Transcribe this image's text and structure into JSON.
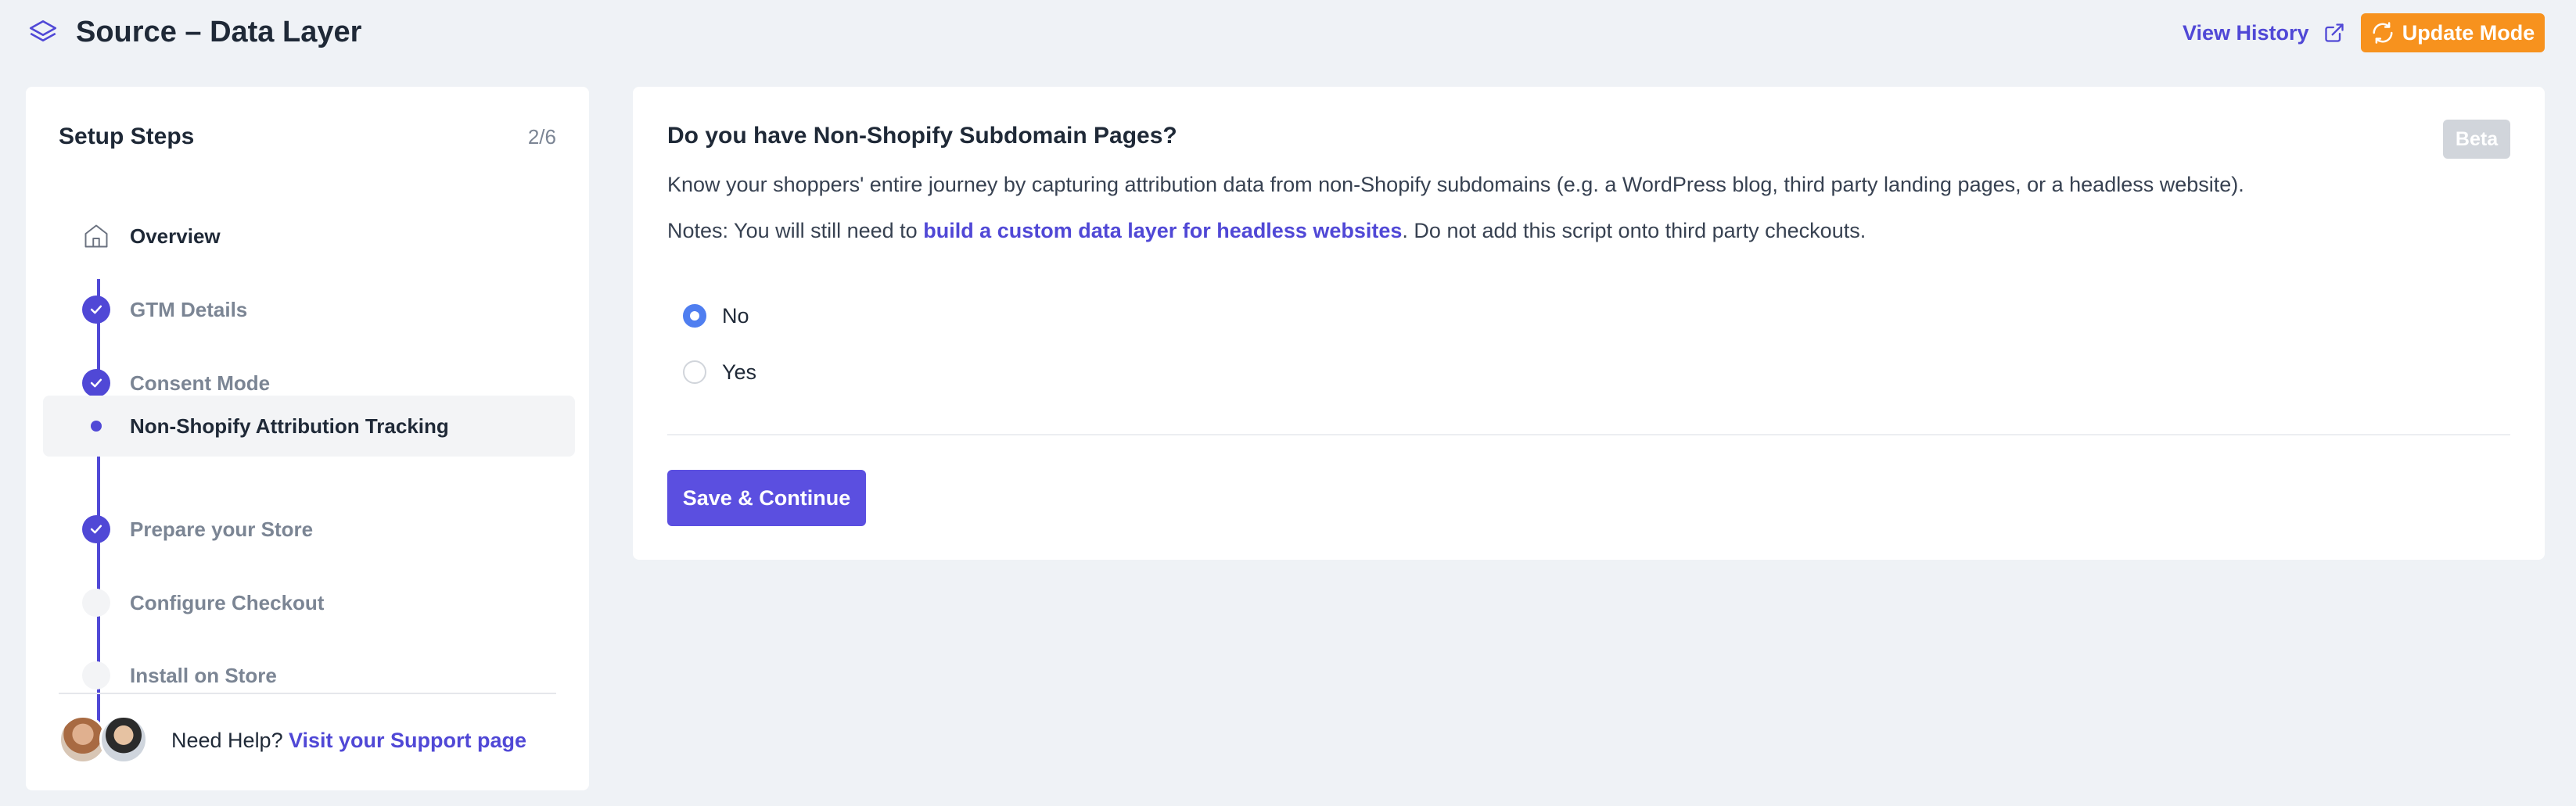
{
  "header": {
    "title": "Source – Data Layer",
    "view_history_label": "View History",
    "update_mode_label": "Update Mode"
  },
  "sidebar": {
    "title": "Setup Steps",
    "progress": "2/6",
    "steps": [
      {
        "label": "Overview",
        "state": "home"
      },
      {
        "label": "GTM Details",
        "state": "done"
      },
      {
        "label": "Consent Mode",
        "state": "done"
      },
      {
        "label": "Non-Shopify Attribution Tracking",
        "state": "current"
      },
      {
        "label": "Prepare your Store",
        "state": "done"
      },
      {
        "label": "Configure Checkout",
        "state": "pending"
      },
      {
        "label": "Install on Store",
        "state": "pending"
      }
    ],
    "help_text": "Need Help?",
    "support_link": "Visit your Support page"
  },
  "main": {
    "question": "Do you have Non-Shopify Subdomain Pages?",
    "badge": "Beta",
    "description": "Know your shoppers' entire journey by capturing attribution data from non-Shopify subdomains (e.g. a WordPress blog, third party landing pages, or a headless website).",
    "notes_prefix": "Notes: You will still need to ",
    "notes_link": "build a custom data layer for headless websites",
    "notes_suffix": ". Do not add this script onto third party checkouts.",
    "options": [
      {
        "label": "No",
        "selected": true
      },
      {
        "label": "Yes",
        "selected": false
      }
    ],
    "save_label": "Save & Continue"
  },
  "colors": {
    "accent": "#5048d6",
    "orange": "#f7921e",
    "radio": "#4f7ef0",
    "background": "#eff2f6"
  }
}
